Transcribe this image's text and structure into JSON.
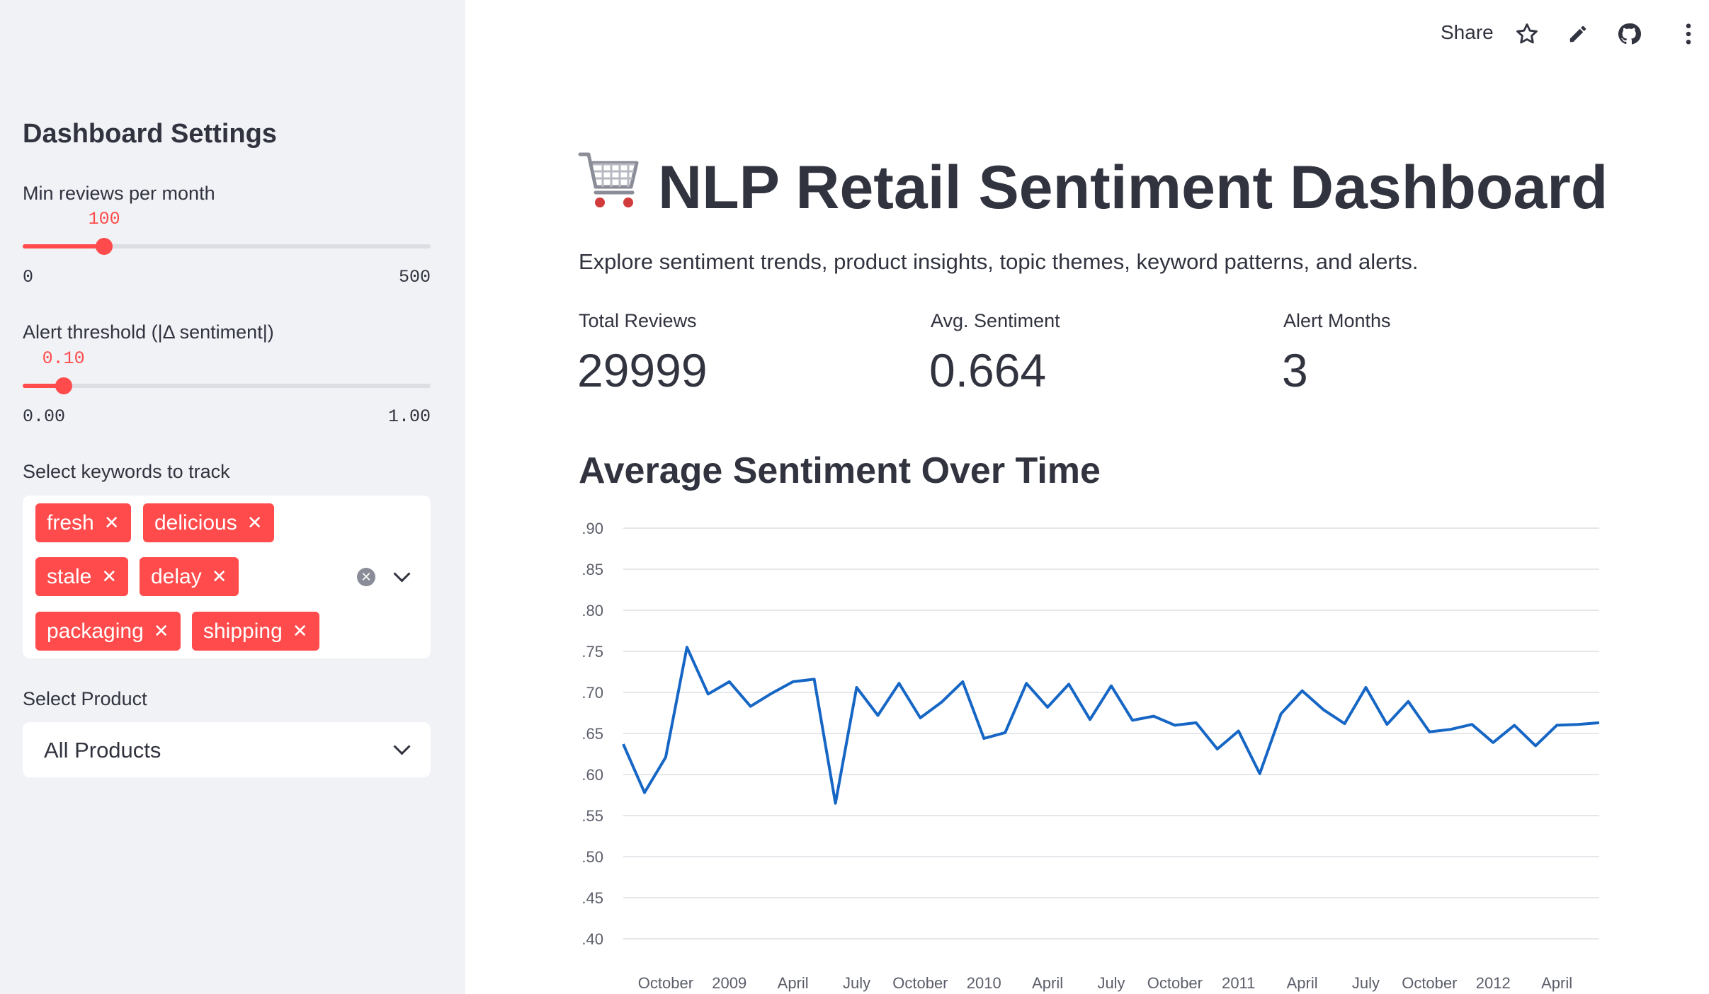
{
  "topbar": {
    "share_label": "Share",
    "icons": [
      "star-icon",
      "edit-icon",
      "github-icon",
      "more-vertical-icon"
    ]
  },
  "sidebar": {
    "title": "Dashboard Settings",
    "min_reviews": {
      "label": "Min reviews per month",
      "value": "100",
      "min": "0",
      "max": "500",
      "fraction": 0.2
    },
    "alert_threshold": {
      "label": "Alert threshold (|Δ sentiment|)",
      "value": "0.10",
      "min": "0.00",
      "max": "1.00",
      "fraction": 0.1
    },
    "keywords": {
      "label": "Select keywords to track",
      "tags": [
        "fresh",
        "delicious",
        "stale",
        "delay",
        "packaging",
        "shipping"
      ]
    },
    "product": {
      "label": "Select Product",
      "value": "All Products"
    }
  },
  "main": {
    "title": "NLP Retail Sentiment Dashboard",
    "title_icon": "shopping-cart-icon",
    "subtitle": "Explore sentiment trends, product insights, topic themes, keyword patterns, and alerts.",
    "metrics": [
      {
        "label": "Total Reviews",
        "value": "29999"
      },
      {
        "label": "Avg. Sentiment",
        "value": "0.664"
      },
      {
        "label": "Alert Months",
        "value": "3"
      }
    ],
    "chart_title": "Average Sentiment Over Time"
  },
  "colors": {
    "accent": "#ff4b4b",
    "line": "#1666c5",
    "sidebar_bg": "#f0f2f6",
    "text": "#31333f"
  },
  "chart_data": {
    "type": "line",
    "title": "Average Sentiment Over Time",
    "ylim": [
      0.4,
      0.9
    ],
    "y_ticks": [
      ".90",
      ".85",
      ".80",
      ".75",
      ".70",
      ".65",
      ".60",
      ".55",
      ".50",
      ".45",
      ".40"
    ],
    "y_tick_values": [
      0.9,
      0.85,
      0.8,
      0.75,
      0.7,
      0.65,
      0.6,
      0.55,
      0.5,
      0.45,
      0.4
    ],
    "x_tick_labels": [
      "October",
      "2009",
      "April",
      "July",
      "October",
      "2010",
      "April",
      "July",
      "October",
      "2011",
      "April",
      "July",
      "October",
      "2012",
      "April"
    ],
    "grid": true,
    "series": [
      {
        "x": [
          "2008-08",
          "2008-09",
          "2008-10",
          "2008-11",
          "2008-12",
          "2009-01",
          "2009-02",
          "2009-03",
          "2009-04",
          "2009-05",
          "2009-06",
          "2009-07",
          "2009-08",
          "2009-09",
          "2009-10",
          "2009-11",
          "2009-12",
          "2010-01",
          "2010-02",
          "2010-03",
          "2010-04",
          "2010-05",
          "2010-06",
          "2010-07",
          "2010-08",
          "2010-09",
          "2010-10",
          "2010-11",
          "2010-12",
          "2011-01",
          "2011-02",
          "2011-03",
          "2011-04",
          "2011-05",
          "2011-06",
          "2011-07",
          "2011-08",
          "2011-09",
          "2011-10",
          "2011-11",
          "2011-12",
          "2012-01",
          "2012-02",
          "2012-03",
          "2012-04",
          "2012-05",
          "2012-06"
        ],
        "values": [
          0.637,
          0.578,
          0.621,
          0.755,
          0.698,
          0.713,
          0.683,
          0.699,
          0.713,
          0.716,
          0.565,
          0.706,
          0.672,
          0.711,
          0.669,
          0.688,
          0.713,
          0.644,
          0.651,
          0.711,
          0.682,
          0.71,
          0.667,
          0.708,
          0.666,
          0.671,
          0.66,
          0.663,
          0.631,
          0.653,
          0.601,
          0.674,
          0.702,
          0.679,
          0.662,
          0.706,
          0.661,
          0.689,
          0.652,
          0.655,
          0.661,
          0.639,
          0.66,
          0.635,
          0.66,
          0.661,
          0.663
        ]
      }
    ]
  }
}
